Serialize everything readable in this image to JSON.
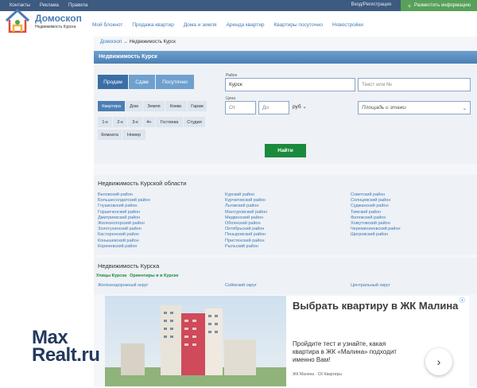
{
  "topbar": {
    "links": [
      "Контакты",
      "Реклама",
      "Правила"
    ],
    "login": "Вход/Регистрация",
    "post": "Разместить информацию"
  },
  "logo": {
    "name": "Домоскоп",
    "subtitle": "Недвижимость Курска"
  },
  "nav": [
    "Мой блокнот",
    "Продажа квартир",
    "Дома и земля",
    "Аренда квартир",
    "Квартиры посуточно",
    "Новостройки"
  ],
  "breadcrumb": {
    "home": "Домоскоп",
    "sep": "→",
    "current": "Недвижимость Курск"
  },
  "section_title": "Недвижимость Курск",
  "search": {
    "tabs": [
      "Продам",
      "Сдам",
      "Посуточно"
    ],
    "types": [
      "Квартира",
      "Дом",
      "Земля",
      "Комм.",
      "Гараж"
    ],
    "rooms": [
      "1-к",
      "2-к",
      "3-к",
      "4+",
      "Гостинка",
      "Студия"
    ],
    "rooms2": [
      "Комната",
      "Номер"
    ],
    "region_label": "Район",
    "region_value": "Курск",
    "text_placeholder": "Текст или №",
    "price_label": "Цена",
    "from_placeholder": "От",
    "to_placeholder": "До",
    "currency": "руб",
    "area_placeholder": "Площадь и этажи",
    "find": "Найти",
    "colors": {
      "tab": "#4a7fb4",
      "find": "#1a8a3c"
    }
  },
  "regions": {
    "title": "Недвижимость Курской области",
    "col1": [
      "Беловский район",
      "Большесолдатский район",
      "Глушковский район",
      "Горшеченский район",
      "Дмитриевский район",
      "Железногорский район",
      "Золотухинский район",
      "Касторенский район",
      "Конышевский район",
      "Кореневский район"
    ],
    "col2": [
      "Курский район",
      "Курчатовский район",
      "Льговский район",
      "Мантуровский район",
      "Медвенский район",
      "Обоянский район",
      "Октябрьский район",
      "Поныровский район",
      "Пристенский район",
      "Рыльский район"
    ],
    "col3": [
      "Советский район",
      "Солнцевский район",
      "Суджанский район",
      "Тимский район",
      "Фатежский район",
      "Хомутовский район",
      "Черемисиновский район",
      "Щигровский район"
    ]
  },
  "city": {
    "title": "Недвижимость Курска",
    "streets": "Улицы Курска",
    "landmarks": "Ориентиры в в Курске",
    "districts": [
      "Железнодорожный округ",
      "Сеймский округ",
      "Центральный округ"
    ]
  },
  "ad": {
    "title": "Выбрать квартиру в ЖК Малина",
    "text": "Пройдите тест и узнайте, какая квартира в ЖК «Малина» подходит именно Вам!",
    "footer": "ЖК Малина · СК Квартиры"
  },
  "watermark": {
    "line1": "Max",
    "line2": "Realt.ru"
  }
}
